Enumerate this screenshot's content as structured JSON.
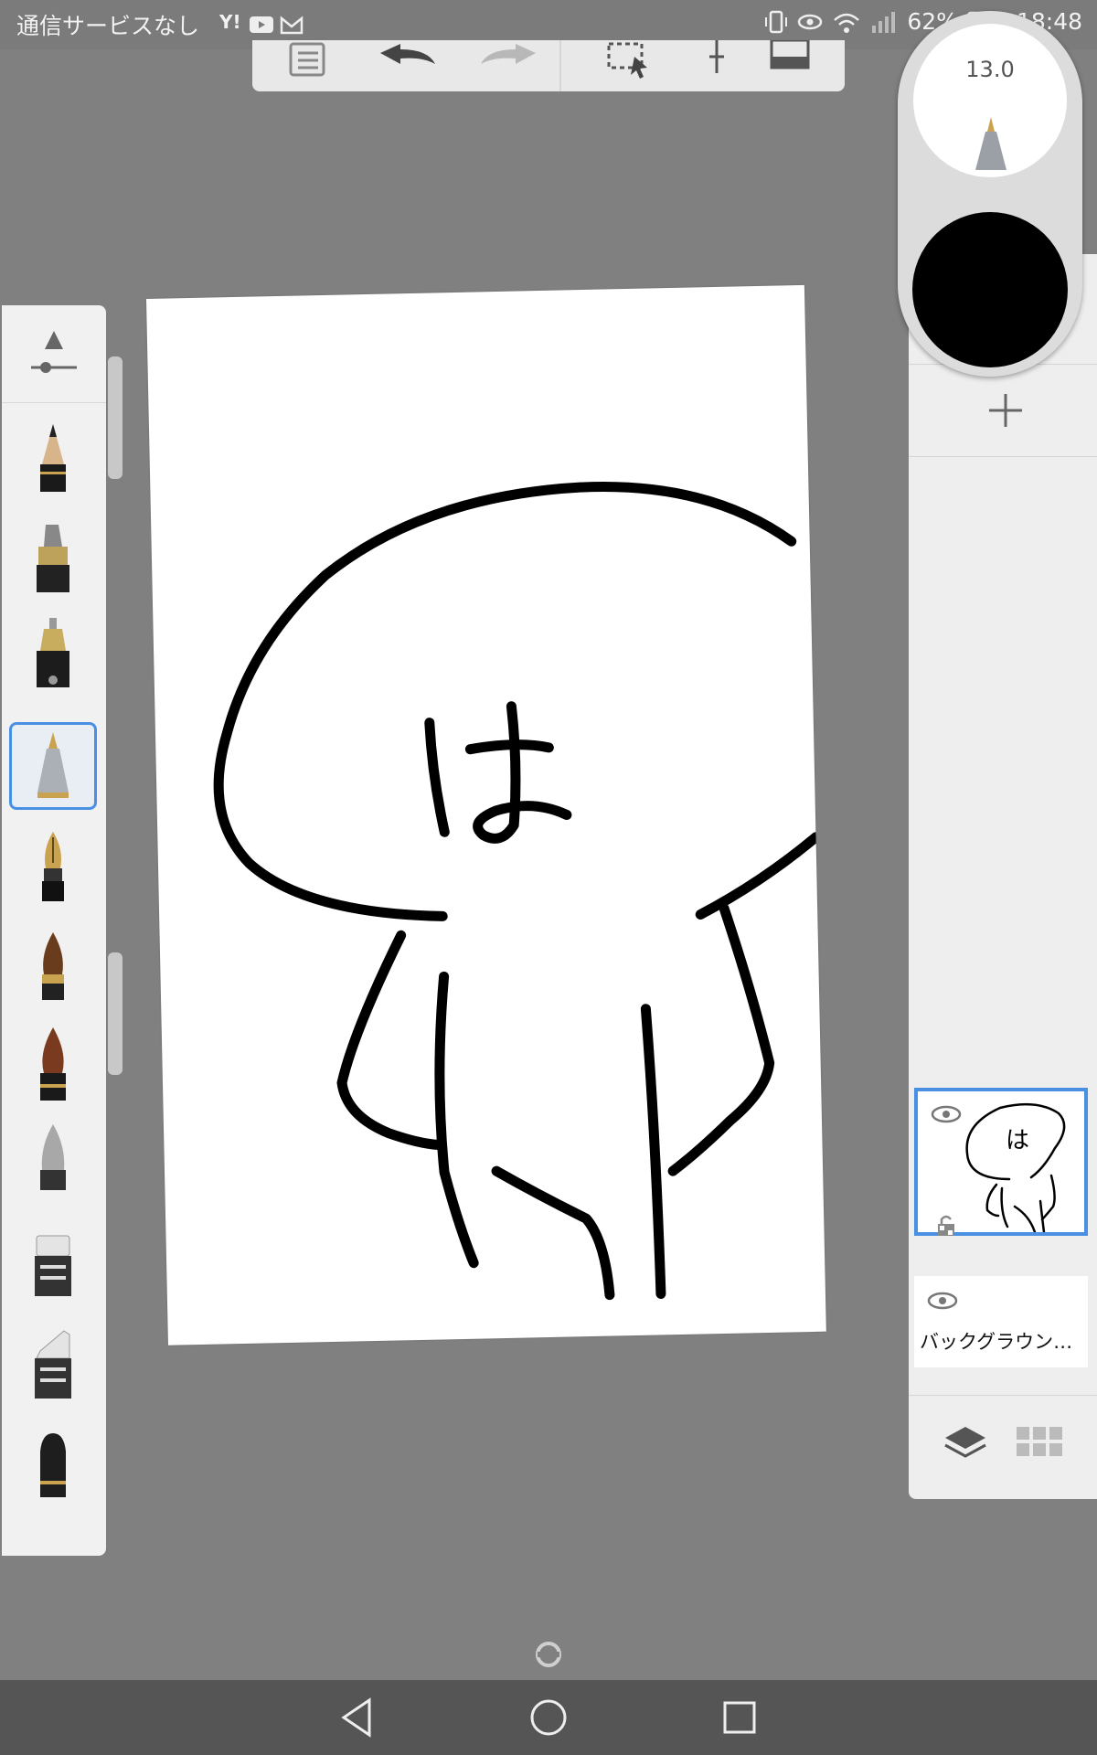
{
  "status_bar": {
    "carrier": "通信サービスなし",
    "battery": "62%",
    "time": "18:48"
  },
  "toolbar": {
    "icons": [
      "list-icon",
      "undo-icon",
      "redo-icon",
      "selection-icon",
      "transform-icon",
      "fullscreen-icon"
    ]
  },
  "brushes": {
    "items": [
      "pencil",
      "marker",
      "technical-pen",
      "ballpoint",
      "fountain-pen",
      "paint-brush",
      "watercolor-brush",
      "airbrush",
      "eraser",
      "soft-eraser",
      "blender"
    ],
    "selected": "ballpoint"
  },
  "puck": {
    "brush_size": "13.0",
    "color": "#000000"
  },
  "canvas": {
    "character_text": "は"
  },
  "layers": {
    "items": [
      {
        "name": "",
        "thumbnail_text": "は",
        "selected": true
      },
      {
        "name": "バックグラウン…",
        "selected": false
      }
    ]
  },
  "colors": {
    "accent": "#4a90e2",
    "background": "#808080"
  }
}
